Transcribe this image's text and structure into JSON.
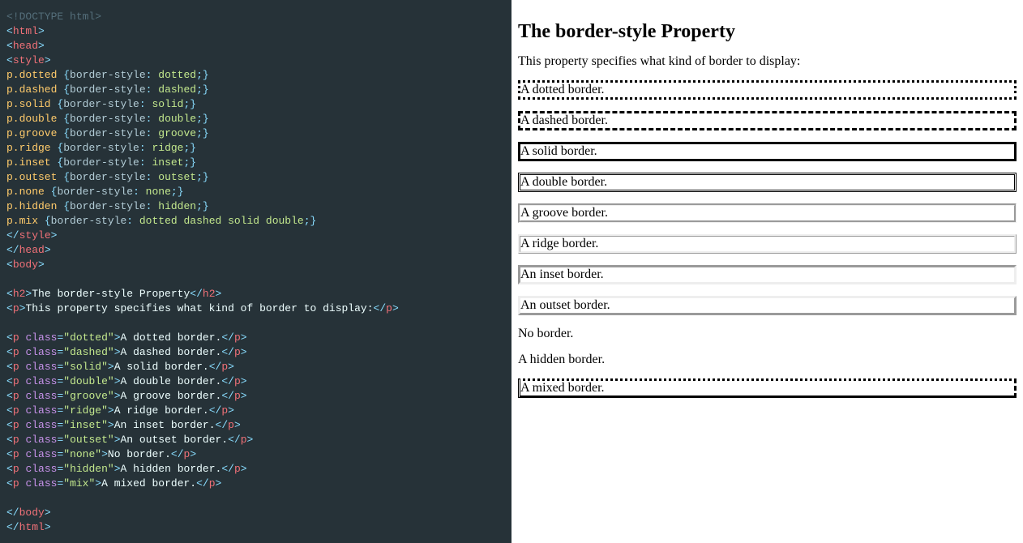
{
  "code": {
    "doctype": "<!DOCTYPE html>",
    "tags": {
      "html_open": "html",
      "head_open": "head",
      "style_open": "style",
      "style_close": "style",
      "head_close": "head",
      "body_open": "body",
      "h2": "h2",
      "p": "p",
      "body_close": "body",
      "html_close": "html"
    },
    "rules": [
      {
        "sel": "p.dotted",
        "prop": "border-style",
        "val": "dotted"
      },
      {
        "sel": "p.dashed",
        "prop": "border-style",
        "val": "dashed"
      },
      {
        "sel": "p.solid",
        "prop": "border-style",
        "val": "solid"
      },
      {
        "sel": "p.double",
        "prop": "border-style",
        "val": "double"
      },
      {
        "sel": "p.groove",
        "prop": "border-style",
        "val": "groove"
      },
      {
        "sel": "p.ridge",
        "prop": "border-style",
        "val": "ridge"
      },
      {
        "sel": "p.inset",
        "prop": "border-style",
        "val": "inset"
      },
      {
        "sel": "p.outset",
        "prop": "border-style",
        "val": "outset"
      },
      {
        "sel": "p.none",
        "prop": "border-style",
        "val": "none"
      },
      {
        "sel": "p.hidden",
        "prop": "border-style",
        "val": "hidden"
      },
      {
        "sel": "p.mix",
        "prop": "border-style",
        "val": "dotted dashed solid double"
      }
    ],
    "h2_text": "The border-style Property",
    "intro_text": "This property specifies what kind of border to display:",
    "class_attr": "class",
    "paras": [
      {
        "cls": "dotted",
        "text": "A dotted border."
      },
      {
        "cls": "dashed",
        "text": "A dashed border."
      },
      {
        "cls": "solid",
        "text": "A solid border."
      },
      {
        "cls": "double",
        "text": "A double border."
      },
      {
        "cls": "groove",
        "text": "A groove border."
      },
      {
        "cls": "ridge",
        "text": "A ridge border."
      },
      {
        "cls": "inset",
        "text": "An inset border."
      },
      {
        "cls": "outset",
        "text": "An outset border."
      },
      {
        "cls": "none",
        "text": "No border."
      },
      {
        "cls": "hidden",
        "text": "A hidden border."
      },
      {
        "cls": "mix",
        "text": "A mixed border."
      }
    ]
  },
  "preview": {
    "heading": "The border-style Property",
    "intro": "This property specifies what kind of border to display:",
    "items": [
      {
        "cls": "p-dotted",
        "text": "A dotted border."
      },
      {
        "cls": "p-dashed",
        "text": "A dashed border."
      },
      {
        "cls": "p-solid",
        "text": "A solid border."
      },
      {
        "cls": "p-double",
        "text": "A double border."
      },
      {
        "cls": "p-groove",
        "text": "A groove border."
      },
      {
        "cls": "p-ridge",
        "text": "A ridge border."
      },
      {
        "cls": "p-inset",
        "text": "An inset border."
      },
      {
        "cls": "p-outset",
        "text": "An outset border."
      },
      {
        "cls": "p-none",
        "text": "No border."
      },
      {
        "cls": "p-hidden",
        "text": "A hidden border."
      },
      {
        "cls": "p-mix",
        "text": "A mixed border."
      }
    ]
  }
}
